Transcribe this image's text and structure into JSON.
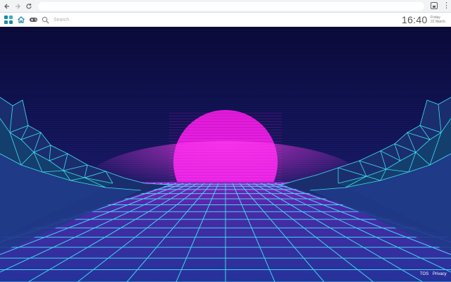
{
  "browser": {
    "back_icon": "arrow-left-icon",
    "forward_icon": "arrow-right-icon",
    "reload_icon": "reload-icon",
    "extension_icon": "extension-icon",
    "menu_icon": "kebab-menu-icon"
  },
  "toolbar": {
    "apps_icon": "apps-grid-icon",
    "home_icon": "home-icon",
    "games_icon": "gamepad-icon",
    "search_icon": "search-icon",
    "search_placeholder": "Search"
  },
  "clock": {
    "time": "16:40",
    "day": "Friday",
    "date": "22 March"
  },
  "footer": {
    "tos": "TOS",
    "privacy": "Privacy"
  },
  "colors": {
    "sky_top": "#0a0a3a",
    "sky_bottom": "#16165a",
    "sun": "#e61ee0",
    "grid": "#3fe0f0",
    "mountains": "#1a2a6a",
    "accent": "#1e88a8"
  }
}
